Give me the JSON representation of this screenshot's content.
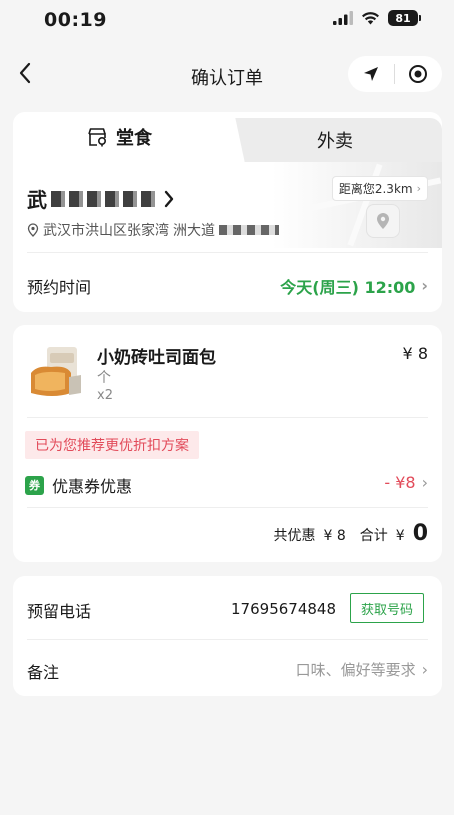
{
  "status_bar": {
    "time": "00:19",
    "battery": "81"
  },
  "nav": {
    "title": "确认订单"
  },
  "tabs": {
    "dine_in": "堂食",
    "takeout": "外卖"
  },
  "store": {
    "name_prefix": "武",
    "address_prefix": "武汉市洪山区张家湾",
    "address_suffix": "洲大道",
    "distance": "距离您2.3km"
  },
  "reserve": {
    "label": "预约时间",
    "value": "今天(周三) 12:00"
  },
  "product": {
    "name": "小奶砖吐司面包",
    "spec": "个",
    "qty": "x2",
    "price": "¥ 8"
  },
  "discount": {
    "recommend": "已为您推荐更优折扣方案",
    "coupon_badge": "券",
    "coupon_label": "优惠券优惠",
    "coupon_value": "- ¥8",
    "total_discount_label": "共优惠",
    "total_discount": "¥ 8",
    "sum_label": "合计",
    "sum_currency": "¥",
    "sum_value": "0"
  },
  "contact": {
    "phone_label": "预留电话",
    "phone_value": "17695674848",
    "get_number": "获取号码",
    "remark_label": "备注",
    "remark_placeholder": "口味、偏好等要求"
  },
  "colors": {
    "accent_green": "#2ca34a",
    "discount_red": "#e24b5a"
  }
}
